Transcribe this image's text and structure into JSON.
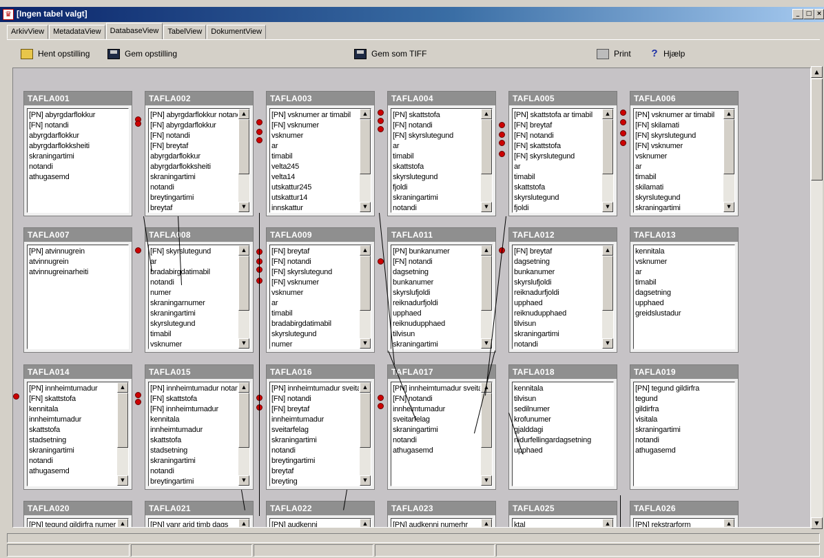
{
  "window": {
    "title": "[Ingen tabel valgt]",
    "minimize": "_",
    "maximize": "□",
    "close": "×"
  },
  "tabs": [
    {
      "label": "ArkivView",
      "active": false
    },
    {
      "label": "MetadataView",
      "active": false
    },
    {
      "label": "DatabaseView",
      "active": true
    },
    {
      "label": "TabelView",
      "active": false
    },
    {
      "label": "DokumentView",
      "active": false
    }
  ],
  "toolbar": {
    "load": "Hent opstilling",
    "save": "Gem opstilling",
    "save_tiff": "Gem som TIFF",
    "print": "Print",
    "help": "Hjælp"
  },
  "scroll": {
    "up": "▲",
    "down": "▼"
  },
  "tables": [
    {
      "name": "TAFLA001",
      "fields": [
        "[PN] abyrgdarflokkur",
        "[FN] notandi",
        "abyrgdarflokkur",
        "abyrgdarflokksheiti",
        "skraningartimi",
        "notandi",
        "athugasemd"
      ]
    },
    {
      "name": "TAFLA002",
      "fields": [
        "[PN] abyrgdarflokkur notandi",
        "[FN] abyrgdarflokkur",
        "[FN] notandi",
        "[FN] breytaf",
        "abyrgdarflokkur",
        "abyrgdarflokksheiti",
        "skraningartimi",
        "notandi",
        "breytingartimi",
        "breytaf"
      ]
    },
    {
      "name": "TAFLA003",
      "fields": [
        "[PN] vsknumer ar timabil",
        "[FN] vsknumer",
        "vsknumer",
        "ar",
        "timabil",
        "velta245",
        "velta14",
        "utskattur245",
        "utskattur14",
        "innskattur"
      ]
    },
    {
      "name": "TAFLA004",
      "fields": [
        "[PN] skattstofa",
        "[FN] notandi",
        "[FN] skyrslutegund",
        "ar",
        "timabil",
        "skattstofa",
        "skyrslutegund",
        "fjoldi",
        "skraningartimi",
        "notandi"
      ]
    },
    {
      "name": "TAFLA005",
      "fields": [
        "[PN] skattstofa ar timabil",
        "[FN] breytaf",
        "[FN] notandi",
        "[FN] skattstofa",
        "[FN] skyrslutegund",
        "ar",
        "timabil",
        "skattstofa",
        "skyrslutegund",
        "fjoldi"
      ]
    },
    {
      "name": "TAFLA006",
      "fields": [
        "[PN] vsknumer ar timabil",
        "[FN] skilamati",
        "[FN] skyrslutegund",
        "[FN] vsknumer",
        "vsknumer",
        "ar",
        "timabil",
        "skilamati",
        "skyrslutegund",
        "skraningartimi"
      ]
    },
    {
      "name": "TAFLA007",
      "fields": [
        "[PN] atvinnugrein",
        "atvinnugrein",
        "atvinnugreinarheiti"
      ]
    },
    {
      "name": "TAFLA008",
      "fields": [
        "[FN] skyrslutegund",
        "ar",
        "bradabirgdatimabil",
        "notandi",
        "numer",
        "skraningarnumer",
        "skraningartimi",
        "skyrslutegund",
        "timabil",
        "vsknumer"
      ]
    },
    {
      "name": "TAFLA009",
      "fields": [
        "[FN] breytaf",
        "[FN] notandi",
        "[FN] skyrslutegund",
        "[FN] vsknumer",
        "vsknumer",
        "ar",
        "timabil",
        "bradabirgdatimabil",
        "skyrslutegund",
        "numer"
      ]
    },
    {
      "name": "TAFLA011",
      "fields": [
        "[PN] bunkanumer",
        "[FN] notandi",
        "dagsetning",
        "bunkanumer",
        "skyrslufjoldi",
        "reiknadurfjoldi",
        "upphaed",
        "reiknudupphaed",
        "tilvisun",
        "skraningartimi"
      ]
    },
    {
      "name": "TAFLA012",
      "fields": [
        "[FN] breytaf",
        "dagsetning",
        "bunkanumer",
        "skyrslufjoldi",
        "reiknadurfjoldi",
        "upphaed",
        "reiknudupphaed",
        "tilvisun",
        "skraningartimi",
        "notandi"
      ]
    },
    {
      "name": "TAFLA013",
      "fields": [
        "kennitala",
        "vsknumer",
        "ar",
        "timabil",
        "dagsetning",
        "upphaed",
        "greidslustadur"
      ]
    },
    {
      "name": "TAFLA014",
      "fields": [
        "[PN] innheimtumadur",
        "[FN] skattstofa",
        "kennitala",
        "innheimtumadur",
        "skattstofa",
        "stadsetning",
        "skraningartimi",
        "notandi",
        "athugasemd"
      ]
    },
    {
      "name": "TAFLA015",
      "fields": [
        "[PN] innheimtumadur notandi",
        "[FN] skattstofa",
        "[FN] innheimtumadur",
        "kennitala",
        "innheimtumadur",
        "skattstofa",
        "stadsetning",
        "skraningartimi",
        "notandi",
        "breytingartimi"
      ]
    },
    {
      "name": "TAFLA016",
      "fields": [
        "[PN] innheimtumadur sveitarfelag",
        "[FN] notandi",
        "[FN] breytaf",
        "innheimtumadur",
        "sveitarfelag",
        "skraningartimi",
        "notandi",
        "breytingartimi",
        "breytaf",
        "breyting"
      ]
    },
    {
      "name": "TAFLA017",
      "fields": [
        "[PN] innheimtumadur sveitarfelag",
        "[FN] notandi",
        "innheimtumadur",
        "sveitarfelag",
        "skraningartimi",
        "notandi",
        "athugasemd"
      ]
    },
    {
      "name": "TAFLA018",
      "fields": [
        "kennitala",
        "tilvisun",
        "sedilnumer",
        "krofunumer",
        "gjalddagi",
        "nidurfellingardagsetning",
        "upphaed"
      ]
    },
    {
      "name": "TAFLA019",
      "fields": [
        "[PN] tegund gildirfra",
        "tegund",
        "gildirfra",
        "visitala",
        "skraningartimi",
        "notandi",
        "athugasemd"
      ]
    },
    {
      "name": "TAFLA020",
      "fields": [
        "[PN] tegund gildirfra numer"
      ]
    },
    {
      "name": "TAFLA021",
      "fields": [
        "[PN] vanr arid timb dags"
      ]
    },
    {
      "name": "TAFLA022",
      "fields": [
        "[PN] audkenni"
      ]
    },
    {
      "name": "TAFLA023",
      "fields": [
        "[PN] audkenni numerhr"
      ]
    },
    {
      "name": "TAFLA025",
      "fields": [
        "ktal"
      ]
    },
    {
      "name": "TAFLA026",
      "fields": [
        "[PN] rekstrarform"
      ]
    }
  ]
}
